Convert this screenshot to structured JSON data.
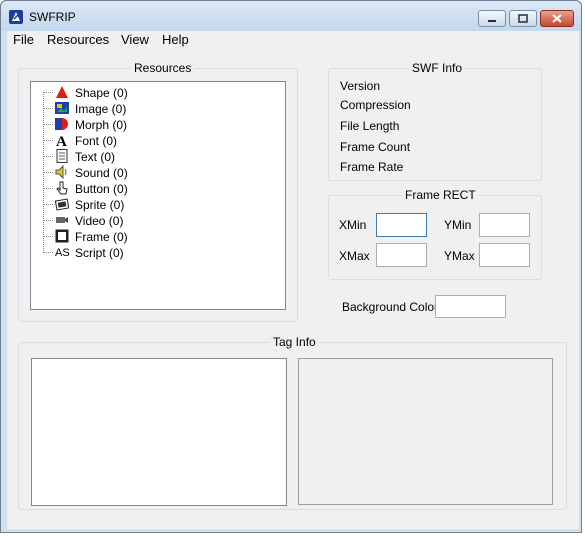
{
  "window": {
    "title": "SWFRIP"
  },
  "menu": [
    "File",
    "Resources",
    "View",
    "Help"
  ],
  "resources": {
    "title": "Resources",
    "items": [
      {
        "label": "Shape (0)",
        "icon": "shape-icon"
      },
      {
        "label": "Image (0)",
        "icon": "image-icon"
      },
      {
        "label": "Morph (0)",
        "icon": "morph-icon"
      },
      {
        "label": "Font (0)",
        "icon": "font-icon"
      },
      {
        "label": "Text (0)",
        "icon": "text-icon"
      },
      {
        "label": "Sound (0)",
        "icon": "sound-icon"
      },
      {
        "label": "Button (0)",
        "icon": "button-icon"
      },
      {
        "label": "Sprite (0)",
        "icon": "sprite-icon"
      },
      {
        "label": "Video (0)",
        "icon": "video-icon"
      },
      {
        "label": "Frame (0)",
        "icon": "frame-icon"
      },
      {
        "label": "Script (0)",
        "icon": "script-icon"
      }
    ]
  },
  "swf_info": {
    "title": "SWF Info",
    "fields": [
      "Version",
      "Compression",
      "File Length",
      "Frame Count",
      "Frame Rate"
    ]
  },
  "frame_rect": {
    "title": "Frame RECT",
    "xmin_label": "XMin",
    "ymin_label": "YMin",
    "xmax_label": "XMax",
    "ymax_label": "YMax",
    "xmin": "",
    "ymin": "",
    "xmax": "",
    "ymax": ""
  },
  "background": {
    "label": "Background Color",
    "value": ""
  },
  "tag_info": {
    "title": "Tag Info"
  },
  "script_glyph": "AS",
  "font_glyph": "A"
}
